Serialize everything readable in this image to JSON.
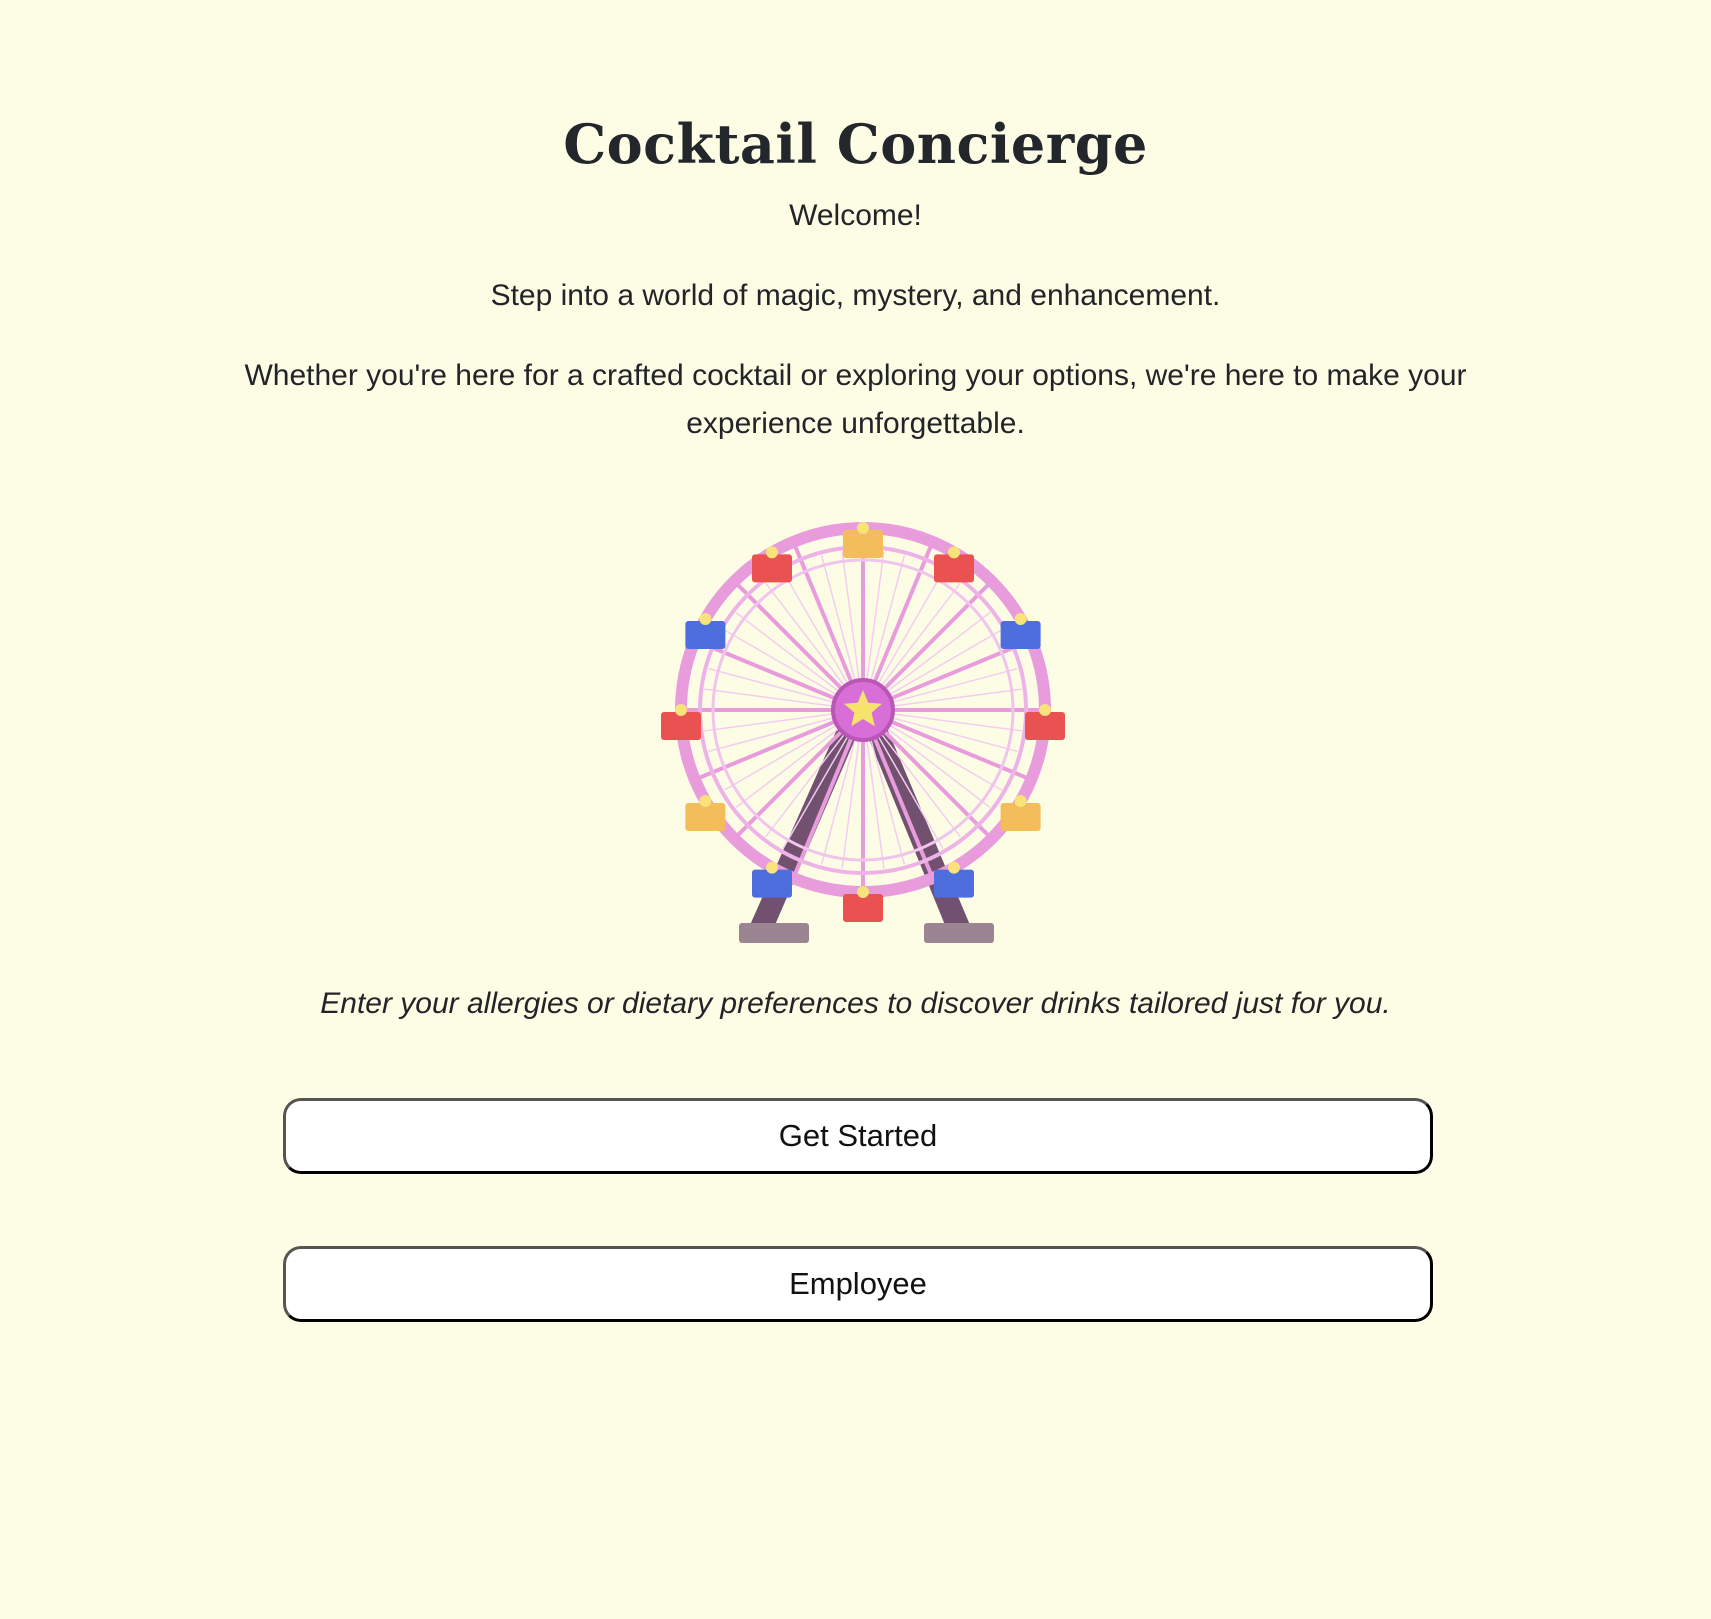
{
  "header": {
    "title": "Cocktail Concierge"
  },
  "intro": {
    "welcome": "Welcome!",
    "tagline": "Step into a world of magic, mystery, and enhancement.",
    "description": "Whether you're here for a crafted cocktail or exploring your options, we're here to make your experience unforgettable."
  },
  "illustration": {
    "icon": "ferris-wheel-icon",
    "colors": {
      "rim": "#e89cdc",
      "hub": "#d86fd6",
      "star": "#f6e36b",
      "legs": "#72506f",
      "base": "#9c8593",
      "cabin_yellow": "#f3bd5c",
      "cabin_red": "#ea5151",
      "cabin_blue": "#4f6ede"
    }
  },
  "prompt": {
    "text": "Enter your allergies or dietary preferences to discover drinks tailored just for you."
  },
  "actions": {
    "get_started_label": "Get Started",
    "employee_label": "Employee"
  },
  "theme": {
    "background": "#fdfde6",
    "text": "#222428",
    "button_background": "#ffffff",
    "button_border": "#000000"
  }
}
